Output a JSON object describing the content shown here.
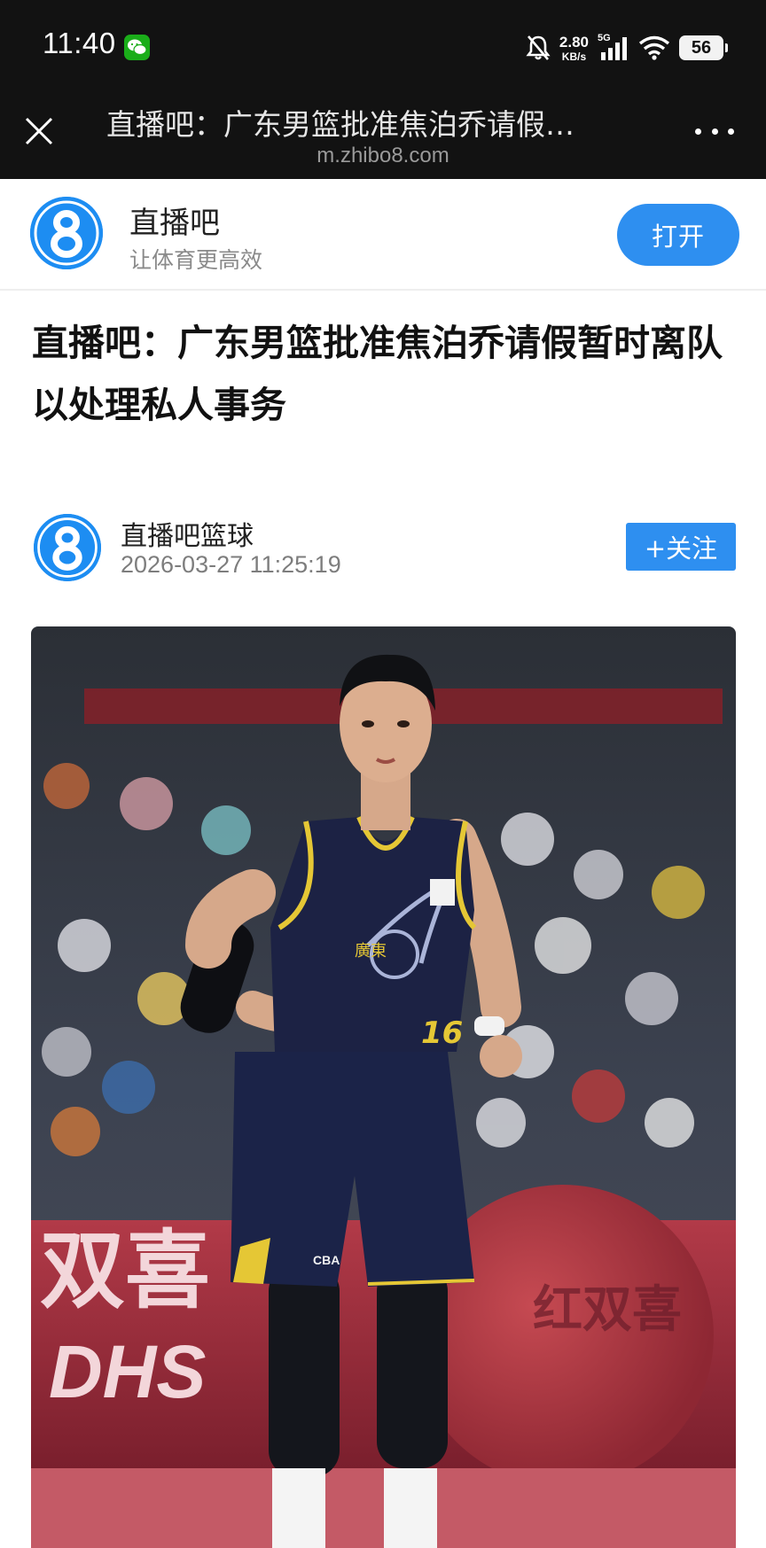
{
  "status_bar": {
    "time": "11:40",
    "net_speed_value": "2.80",
    "net_speed_unit": "KB/s",
    "network_type": "5G",
    "battery": "56",
    "icons": [
      "wechat-icon",
      "bell-muted-icon",
      "signal-icon",
      "wifi-icon",
      "battery-icon"
    ]
  },
  "browser": {
    "page_title": "直播吧：广东男篮批准焦泊乔请假…",
    "url": "m.zhibo8.com",
    "close_icon": "close-icon",
    "more_icon": "more-dots-icon"
  },
  "app_banner": {
    "name": "直播吧",
    "slogan": "让体育更高效",
    "open_label": "打开"
  },
  "article": {
    "title": "直播吧：广东男篮批准焦泊乔请假暂时离队以处理私人事务",
    "author": "直播吧篮球",
    "publish_time": "2026-03-27 11:25:19",
    "follow_label": "+关注"
  },
  "photo": {
    "jersey_team": "廣東",
    "jersey_number": "16",
    "ad_text_cn": "双喜",
    "ad_text_en": "DHS",
    "ball_text": "红双喜",
    "shorts_logo": "CBA"
  },
  "colors": {
    "accent_blue": "#2e8ff0",
    "status_bg": "#121212",
    "wechat_green": "#1aad19"
  }
}
